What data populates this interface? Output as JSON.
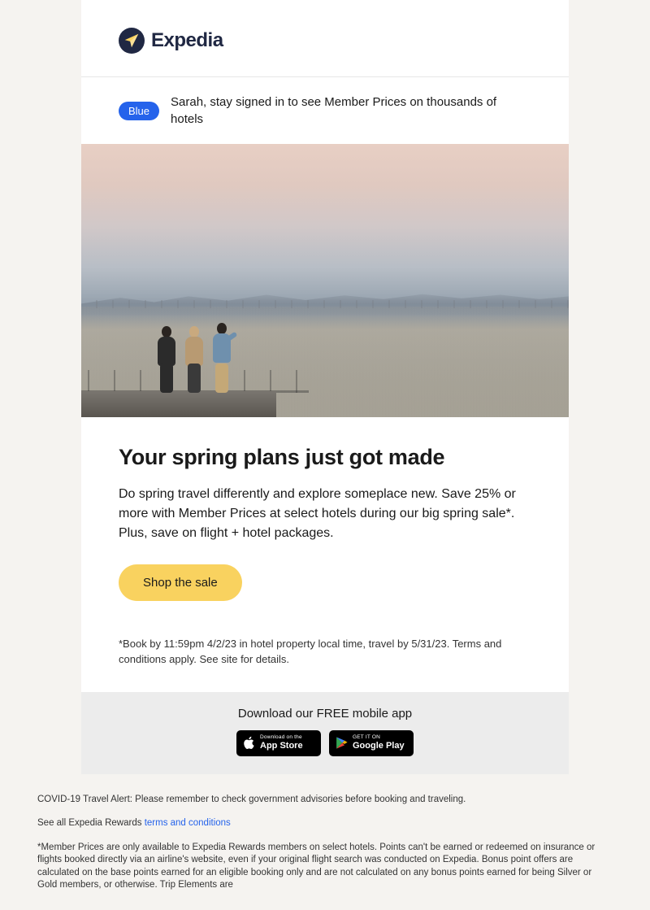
{
  "brand": {
    "name": "Expedia"
  },
  "member_bar": {
    "badge": "Blue",
    "message": "Sarah, stay signed in to see Member Prices on thousands of hotels"
  },
  "content": {
    "headline": "Your spring plans just got made",
    "body": "Do spring travel differently and explore someplace new. Save 25% or more with Member Prices at select hotels during our big spring sale*. Plus, save on flight + hotel packages.",
    "cta_label": "Shop the sale",
    "fine_print": "*Book by 11:59pm 4/2/23 in hotel property local time, travel by 5/31/23. Terms and conditions apply. See site for details."
  },
  "app_section": {
    "title": "Download our FREE mobile app",
    "apple": {
      "top": "Download on the",
      "bottom": "App Store"
    },
    "google": {
      "top": "GET IT ON",
      "bottom": "Google Play"
    }
  },
  "footer": {
    "covid": "COVID-19 Travel Alert: Please remember to check government advisories before booking and traveling.",
    "rewards_prefix": "See all Expedia Rewards ",
    "rewards_link": "terms and conditions",
    "member_disclaimer": "*Member Prices are only available to Expedia Rewards members on select hotels. Points can't be earned or redeemed on insurance or flights booked directly via an airline's website, even if your original flight search was conducted on Expedia. Bonus point offers are calculated on the base points earned for an eligible booking only and are not calculated on any bonus points earned for being Silver or Gold members, or otherwise. Trip Elements are"
  }
}
